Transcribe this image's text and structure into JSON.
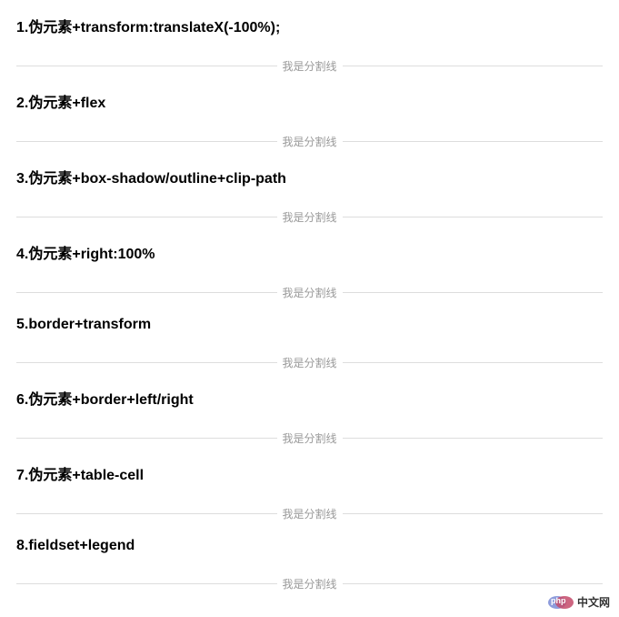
{
  "sections": [
    {
      "heading": "1.伪元素+transform:translateX(-100%);",
      "divider": "我是分割线"
    },
    {
      "heading": "2.伪元素+flex",
      "divider": "我是分割线"
    },
    {
      "heading": "3.伪元素+box-shadow/outline+clip-path",
      "divider": "我是分割线"
    },
    {
      "heading": "4.伪元素+right:100%",
      "divider": "我是分割线"
    },
    {
      "heading": "5.border+transform",
      "divider": "我是分割线"
    },
    {
      "heading": "6.伪元素+border+left/right",
      "divider": "我是分割线"
    },
    {
      "heading": "7.伪元素+table-cell",
      "divider": "我是分割线"
    },
    {
      "heading": "8.fieldset+legend",
      "divider": "我是分割线"
    }
  ],
  "watermark": {
    "logo_text": "php",
    "site_text": "中文网"
  }
}
